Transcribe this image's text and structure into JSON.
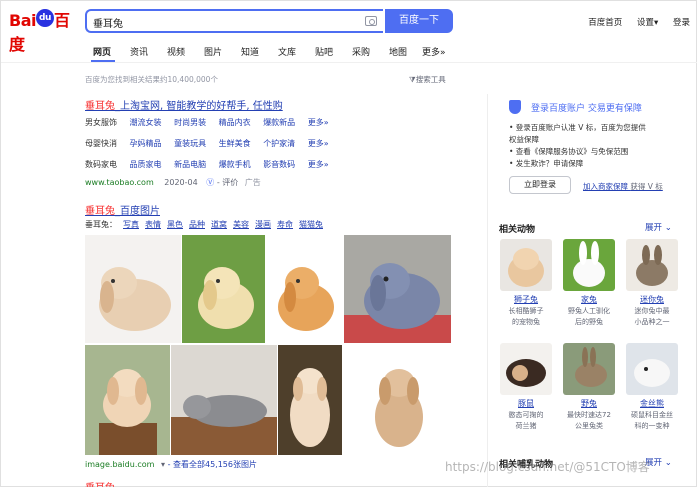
{
  "header": {
    "logo_text": "Bai",
    "logo_paw": "du",
    "logo_suffix": "百度",
    "query": "垂耳兔",
    "search_button": "百度一下",
    "links": [
      "百度首页",
      "设置▾",
      "登录"
    ]
  },
  "tabs": [
    "网页",
    "资讯",
    "视频",
    "图片",
    "知道",
    "文库",
    "贴吧",
    "采购",
    "地图",
    "更多»"
  ],
  "result_count": "百度为您找到相关结果约10,400,000个",
  "tools_label": "搜索工具",
  "result1": {
    "title_hl": "垂耳兔",
    "title_rest": "_上淘宝网, 智能教学的好帮手, 任性购",
    "rows": [
      [
        "男女服饰",
        "潮流女装",
        "时尚男装",
        "精品内衣",
        "爆款新品",
        "更多»"
      ],
      [
        "母婴快消",
        "孕妈精品",
        "童装玩具",
        "生鲜美食",
        "个护家清",
        "更多»"
      ],
      [
        "数码家电",
        "品质家电",
        "新品电脑",
        "爆款手机",
        "影音数码",
        "更多»"
      ]
    ],
    "url": "www.taobao.com",
    "date": "2020-04",
    "eval": "- 评价",
    "ad": "广告"
  },
  "result2": {
    "title_hl": "垂耳兔",
    "title_rest": "_百度图片",
    "tags_label": "垂耳兔：",
    "tags": [
      "写真",
      "表情",
      "黑色",
      "品种",
      "道窝",
      "美容",
      "漫画",
      "寿命",
      "猫猫兔"
    ],
    "source": "image.baidu.com",
    "view_all": "- 查看全部45,156张图片"
  },
  "login": {
    "title": "登录百度账户  交易更有保障",
    "lines": [
      "• 登录百度账户认准 V 标，百度为您提供",
      "权益保障",
      "• 查看《保障服务协议》与免保范围",
      "• 发生欺诈？申请保障"
    ],
    "login_button": "立即登录",
    "join_link": "加入商家保障",
    "join_suffix": "获得 V 标"
  },
  "related_animals": {
    "title": "相关动物",
    "expand": "展开",
    "items": [
      {
        "name": "狮子兔",
        "desc": [
          "长相酷狮子",
          "的宠物兔"
        ]
      },
      {
        "name": "家兔",
        "desc": [
          "野兔人工驯化",
          "后的野兔"
        ]
      },
      {
        "name": "迷你兔",
        "desc": [
          "迷你兔中最",
          "小品种之一"
        ]
      },
      {
        "name": "豚鼠",
        "desc": [
          "憨态可掬的",
          "荷兰猪"
        ]
      },
      {
        "name": "野兔",
        "desc": [
          "最快时速达72",
          "公里兔类"
        ]
      },
      {
        "name": "金丝熊",
        "desc": [
          "硕鼠科目金丝",
          "科的一变种"
        ]
      }
    ]
  },
  "related_mammals": {
    "title": "相关哺乳动物",
    "expand": "展开"
  },
  "watermark": "https://blog.csdn.net/@51CTO博客",
  "colors": {
    "accent": "#4e6ef2",
    "link": "#2440b3",
    "highlight": "#f73131",
    "url_green": "#1a7c23"
  }
}
